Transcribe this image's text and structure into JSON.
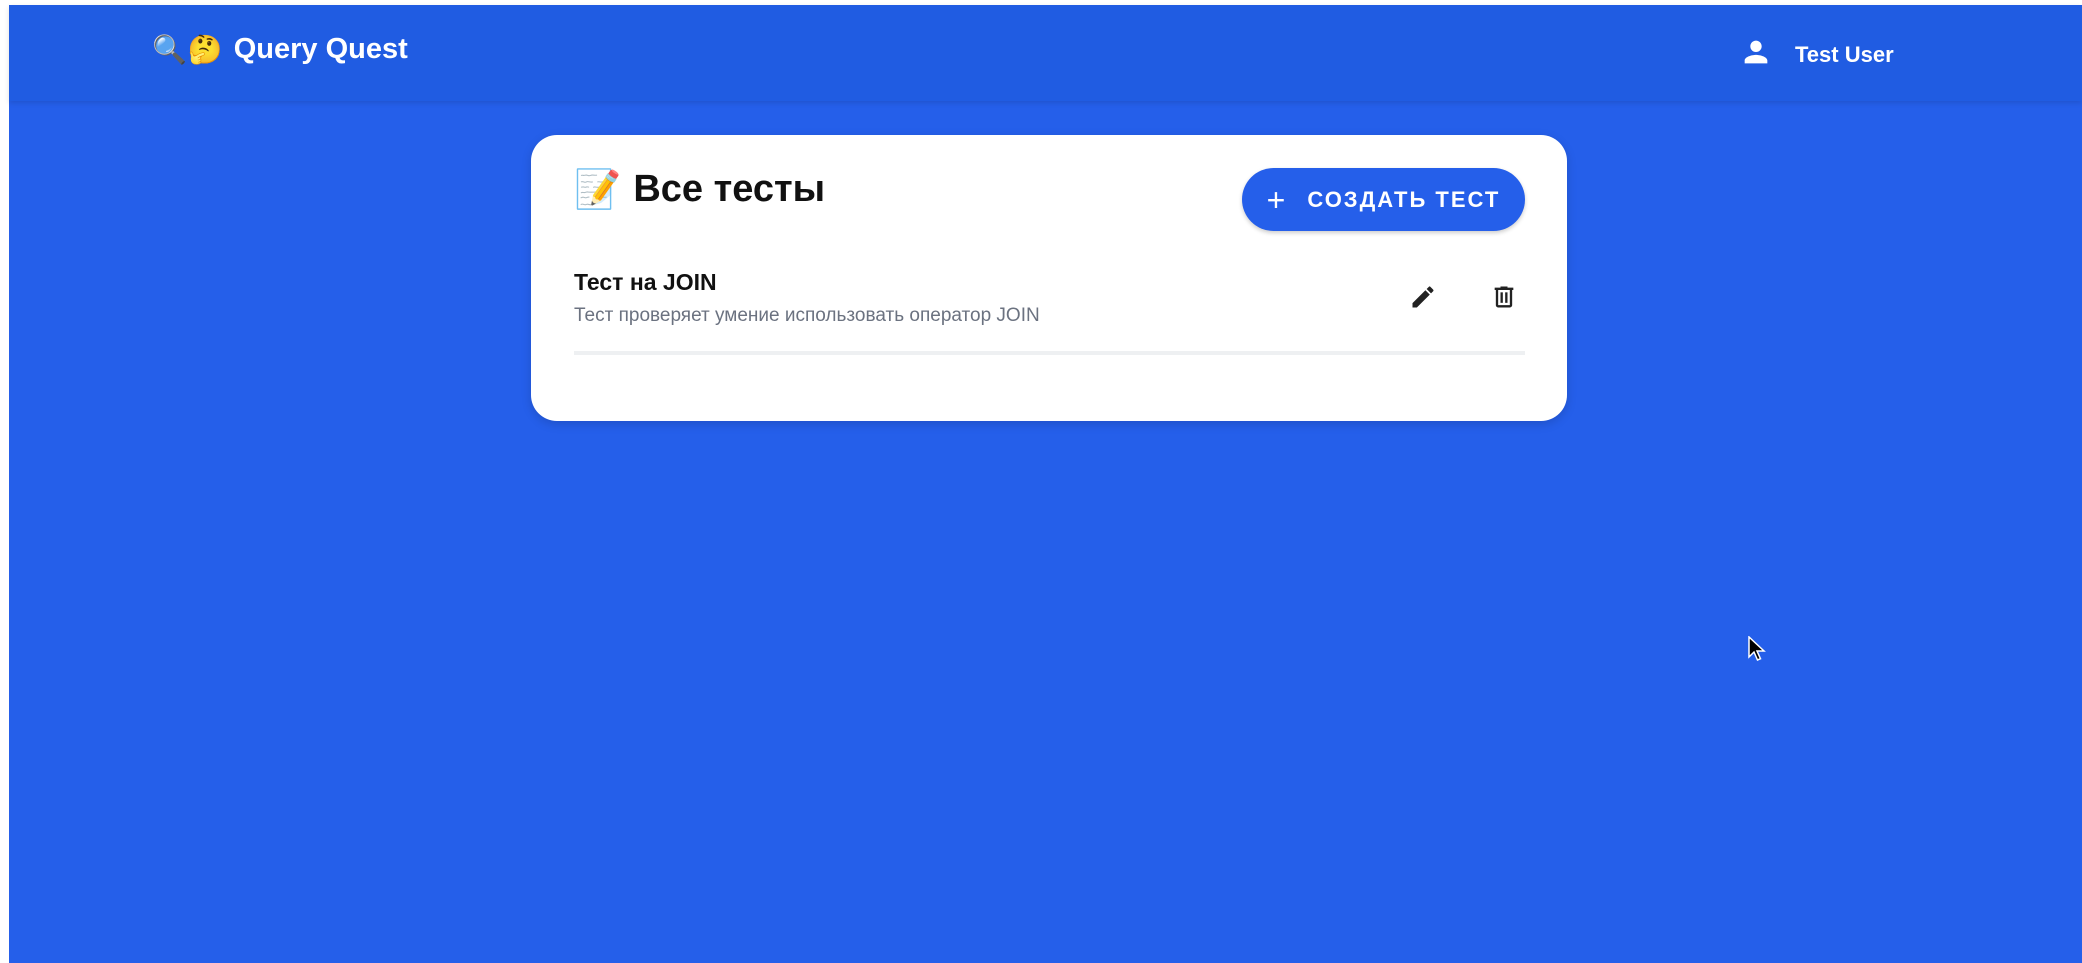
{
  "header": {
    "brand_emoji": "🔍🤔",
    "brand_name": "Query Quest",
    "user_icon": "person-icon",
    "user_name": "Test User"
  },
  "card": {
    "title_emoji": "📝",
    "title": "Все тесты",
    "create_button": {
      "icon": "plus-icon",
      "label": "СОЗДАТЬ ТЕСТ"
    },
    "tests": [
      {
        "title": "Тест на JOIN",
        "description": "Тест проверяет умение использовать оператор JOIN",
        "actions": [
          "pencil-icon",
          "trash-icon"
        ]
      }
    ]
  },
  "colors": {
    "background": "#255fea",
    "topbar": "#205ce2",
    "accent": "#255fea",
    "card": "#ffffff"
  }
}
